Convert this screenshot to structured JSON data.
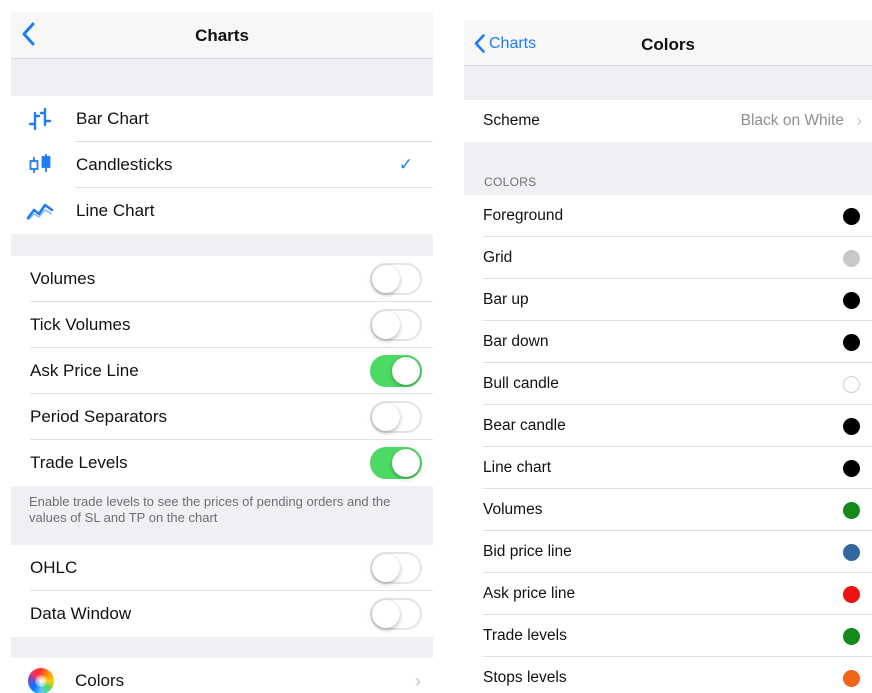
{
  "left": {
    "nav": {
      "title": "Charts"
    },
    "chart_types": [
      {
        "label": "Bar Chart",
        "icon": "bar-chart-icon",
        "checked": false
      },
      {
        "label": "Candlesticks",
        "icon": "candlestick-icon",
        "checked": true
      },
      {
        "label": "Line Chart",
        "icon": "line-chart-icon",
        "checked": false
      }
    ],
    "check_glyph": "✓",
    "toggles": [
      {
        "label": "Volumes",
        "on": false
      },
      {
        "label": "Tick Volumes",
        "on": false
      },
      {
        "label": "Ask Price Line",
        "on": true
      },
      {
        "label": "Period Separators",
        "on": false
      },
      {
        "label": "Trade Levels",
        "on": true
      }
    ],
    "trade_levels_note": "Enable trade levels to see the prices of pending orders and the values of SL and TP on the chart",
    "toggles2": [
      {
        "label": "OHLC",
        "on": false
      },
      {
        "label": "Data Window",
        "on": false
      }
    ],
    "colors_row": {
      "label": "Colors",
      "icon": "color-wheel-icon"
    }
  },
  "right": {
    "nav": {
      "back_label": "Charts",
      "title": "Colors"
    },
    "scheme": {
      "label": "Scheme",
      "value": "Black on White"
    },
    "colors_header": "COLORS",
    "colors": [
      {
        "label": "Foreground",
        "color": "#000000"
      },
      {
        "label": "Grid",
        "color": "#c8c8c8"
      },
      {
        "label": "Bar up",
        "color": "#000000"
      },
      {
        "label": "Bar down",
        "color": "#000000"
      },
      {
        "label": "Bull candle",
        "color": "#ffffff"
      },
      {
        "label": "Bear candle",
        "color": "#000000"
      },
      {
        "label": "Line chart",
        "color": "#000000"
      },
      {
        "label": "Volumes",
        "color": "#138a1b"
      },
      {
        "label": "Bid price line",
        "color": "#33679e"
      },
      {
        "label": "Ask price line",
        "color": "#ef1212"
      },
      {
        "label": "Trade levels",
        "color": "#138a1b"
      },
      {
        "label": "Stops levels",
        "color": "#f06418"
      }
    ]
  },
  "accent_color": "#1e7cf5",
  "toggle_on_color": "#4cd964"
}
